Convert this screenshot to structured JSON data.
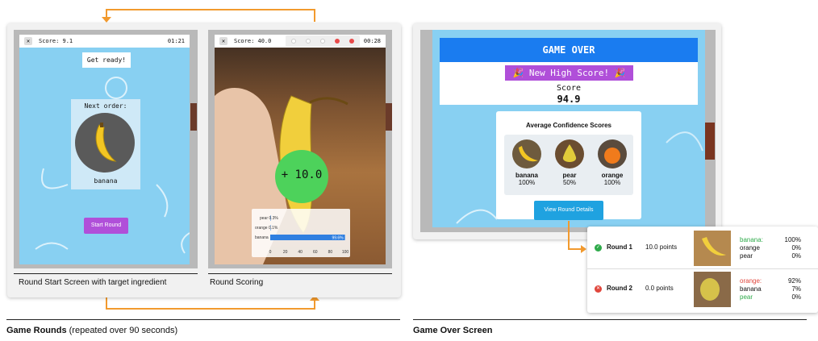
{
  "left_section": {
    "title_bold": "Game Rounds",
    "title_rest": " (repeated over 90 seconds)",
    "screen1": {
      "close": "✕",
      "score": "Score: 9.1",
      "timer": "01:21",
      "get_ready": "Get ready!",
      "next_order": "Next order:",
      "target": "banana",
      "start_button": "Start Round",
      "caption": "Round Start Screen with target ingredient"
    },
    "screen2": {
      "close": "✕",
      "score": "Score: 40.0",
      "timer": "00:28",
      "points_popup": "+ 10.0",
      "caption": "Round Scoring",
      "chart_data": {
        "type": "bar",
        "categories": [
          "pear",
          "orange",
          "banana"
        ],
        "values": [
          0.3,
          0.1,
          99.6
        ],
        "value_labels": [
          "pear 0.3%",
          "orange 0.1%",
          "99.6%"
        ],
        "xticks": [
          "0",
          "20",
          "40",
          "60",
          "80",
          "100"
        ],
        "xlim": [
          0,
          100
        ],
        "color": "#2f7fe0"
      }
    }
  },
  "right_section": {
    "title": "Game Over Screen",
    "game_over": "GAME OVER",
    "high_score": "🎉 New High Score! 🎉",
    "score_label": "Score",
    "score_value": "94.9",
    "avg_title": "Average Confidence Scores",
    "fruits": [
      {
        "name": "banana",
        "pct": "100%"
      },
      {
        "name": "pear",
        "pct": "50%"
      },
      {
        "name": "orange",
        "pct": "100%"
      }
    ],
    "details_button": "View Round Details",
    "rounds": [
      {
        "label": "Round 1",
        "points": "10.0 points",
        "status": "correct",
        "scores": [
          {
            "name": "banana:",
            "pct": "100%",
            "color": "#2eaa4a"
          },
          {
            "name": "orange",
            "pct": "0%",
            "color": "#111"
          },
          {
            "name": "pear",
            "pct": "0%",
            "color": "#111"
          }
        ]
      },
      {
        "label": "Round 2",
        "points": "0.0 points",
        "status": "wrong",
        "scores": [
          {
            "name": "orange:",
            "pct": "92%",
            "color": "#e0463c"
          },
          {
            "name": "banana",
            "pct": "7%",
            "color": "#111"
          },
          {
            "name": "pear",
            "pct": "0%",
            "color": "#2eaa4a"
          }
        ]
      }
    ]
  },
  "colors": {
    "accent_arrow": "#f29a2e",
    "sky": "#88d0f2",
    "purple": "#b04fd9",
    "blue": "#1a7cf0"
  }
}
